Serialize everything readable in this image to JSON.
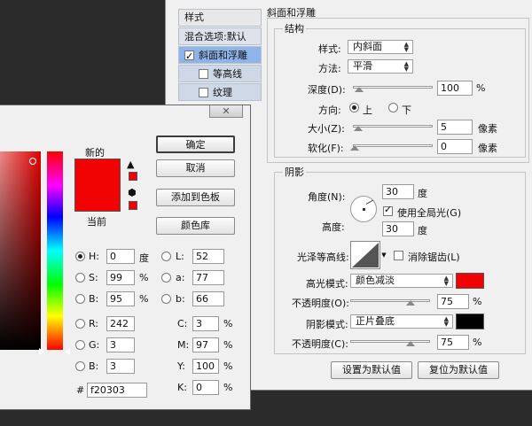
{
  "layer_style": {
    "sidebar": {
      "header": "样式",
      "items": [
        {
          "label": "混合选项:默认"
        },
        {
          "label": "斜面和浮雕",
          "checked": true,
          "selected": true
        },
        {
          "label": "等高线",
          "checked": false
        },
        {
          "label": "纹理",
          "checked": false
        }
      ]
    },
    "bevel": {
      "title": "斜面和浮雕",
      "structure_title": "结构",
      "style_label": "样式:",
      "style_value": "内斜面",
      "technique_label": "方法:",
      "technique_value": "平滑",
      "depth_label": "深度(D):",
      "depth_value": "100",
      "depth_unit": "%",
      "direction_label": "方向:",
      "direction_up": "上",
      "direction_down": "下",
      "size_label": "大小(Z):",
      "size_value": "5",
      "size_unit": "像素",
      "soften_label": "软化(F):",
      "soften_value": "0",
      "soften_unit": "像素"
    },
    "shading": {
      "title": "阴影",
      "angle_label": "角度(N):",
      "angle_value": "30",
      "angle_unit": "度",
      "global_light_label": "使用全局光(G)",
      "altitude_label": "高度:",
      "altitude_value": "30",
      "altitude_unit": "度",
      "gloss_label": "光泽等高线:",
      "antialias_label": "消除锯齿(L)",
      "highlight_mode_label": "高光模式:",
      "highlight_mode_value": "颜色减淡",
      "highlight_color": "#f20303",
      "highlight_opacity_label": "不透明度(O):",
      "highlight_opacity_value": "75",
      "highlight_opacity_unit": "%",
      "shadow_mode_label": "阴影模式:",
      "shadow_mode_value": "正片叠底",
      "shadow_color": "#000000",
      "shadow_opacity_label": "不透明度(C):",
      "shadow_opacity_value": "75",
      "shadow_opacity_unit": "%"
    },
    "buttons": {
      "set_default": "设置为默认值",
      "reset_default": "复位为默认值"
    }
  },
  "color_picker": {
    "close_icon": "close-icon",
    "new_label": "新的",
    "current_label": "当前",
    "new_color": "#f20303",
    "current_color": "#f20303",
    "buttons": {
      "ok": "确定",
      "cancel": "取消",
      "add_swatch": "添加到色板",
      "libraries": "颜色库"
    },
    "hsb": {
      "h_label": "H:",
      "h_value": "0",
      "h_unit": "度",
      "s_label": "S:",
      "s_value": "99",
      "s_unit": "%",
      "b_label": "B:",
      "b_value": "95",
      "b_unit": "%"
    },
    "rgb": {
      "r_label": "R:",
      "r_value": "242",
      "g_label": "G:",
      "g_value": "3",
      "b_label": "B:",
      "b_value": "3"
    },
    "lab": {
      "l_label": "L:",
      "l_value": "52",
      "a_label": "a:",
      "a_value": "77",
      "b_label": "b:",
      "b_value": "66"
    },
    "cmyk": {
      "c_label": "C:",
      "c_value": "3",
      "c_unit": "%",
      "m_label": "M:",
      "m_value": "97",
      "m_unit": "%",
      "y_label": "Y:",
      "y_value": "100",
      "y_unit": "%",
      "k_label": "K:",
      "k_value": "0",
      "k_unit": "%"
    },
    "hex_label": "#",
    "hex_value": "f20303"
  }
}
